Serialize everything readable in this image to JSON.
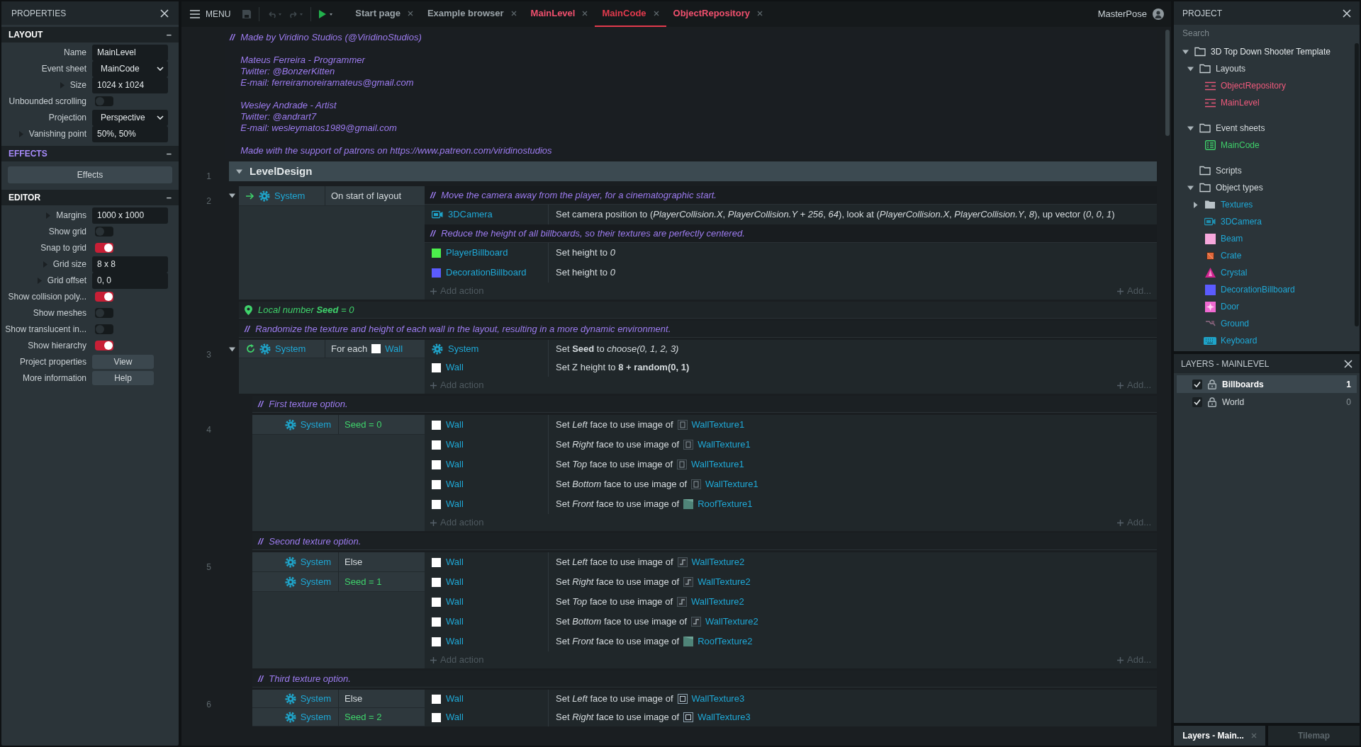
{
  "properties": {
    "title": "PROPERTIES",
    "sections": [
      {
        "title": "LAYOUT",
        "color": "#ffffff",
        "collapse": "–",
        "rows": [
          {
            "kind": "field",
            "label": "Name",
            "value": "MainLevel"
          },
          {
            "kind": "select",
            "label": "Event sheet",
            "value": "MainCode"
          },
          {
            "kind": "field",
            "label": "Size",
            "value": "1024 x 1024",
            "expandable": true
          },
          {
            "kind": "toggle",
            "label": "Unbounded scrolling",
            "on": false
          },
          {
            "kind": "select",
            "label": "Projection",
            "value": "Perspective"
          },
          {
            "kind": "field",
            "label": "Vanishing point",
            "value": "50%, 50%",
            "expandable": true
          }
        ]
      },
      {
        "title": "EFFECTS",
        "color": "#a78bfa",
        "collapse": "–",
        "rows": [
          {
            "kind": "wide_button",
            "value": "Effects"
          }
        ]
      },
      {
        "title": "EDITOR",
        "color": "#ffffff",
        "collapse": "–",
        "rows": [
          {
            "kind": "field",
            "label": "Margins",
            "value": "1000 x 1000",
            "expandable": true
          },
          {
            "kind": "toggle",
            "label": "Show grid",
            "on": false
          },
          {
            "kind": "toggle",
            "label": "Snap to grid",
            "on": true
          },
          {
            "kind": "field",
            "label": "Grid size",
            "value": "8 x 8",
            "expandable": true
          },
          {
            "kind": "field",
            "label": "Grid offset",
            "value": "0, 0",
            "expandable": true
          },
          {
            "kind": "toggle",
            "label": "Show collision poly...",
            "on": true
          },
          {
            "kind": "toggle",
            "label": "Show meshes",
            "on": false
          },
          {
            "kind": "toggle",
            "label": "Show translucent in...",
            "on": false
          },
          {
            "kind": "toggle",
            "label": "Show hierarchy",
            "on": true
          },
          {
            "kind": "button",
            "label": "Project properties",
            "value": "View"
          },
          {
            "kind": "button",
            "label": "More information",
            "value": "Help"
          }
        ]
      }
    ]
  },
  "toolbar": {
    "menu": "MENU",
    "user": "MasterPose"
  },
  "tabs": [
    {
      "label": "Start page",
      "kind": "page",
      "selected": false
    },
    {
      "label": "Example browser",
      "kind": "page",
      "selected": false
    },
    {
      "label": "MainLevel",
      "kind": "project",
      "selected": false
    },
    {
      "label": "MainCode",
      "kind": "project",
      "selected": true
    },
    {
      "label": "ObjectRepository",
      "kind": "project",
      "selected": false
    }
  ],
  "sheet": {
    "header_comment": {
      "marker": "//",
      "paragraphs": [
        [
          "Made by Viridino Studios (@ViridinoStudios)"
        ],
        [
          "Mateus Ferreira - Programmer",
          "Twitter: @BonzerKitten",
          "E-mail: ferreiramoreiramateus@gmail.com"
        ],
        [
          "Wesley Andrade - Artist",
          "Twitter: @andrart7",
          "E-mail: wesleymatos1989@gmail.com"
        ],
        [
          "Made with the support of patrons on https://www.patreon.com/viridinostudios"
        ]
      ]
    },
    "events": [
      {
        "kind": "group",
        "number": "1",
        "title": "LevelDesign",
        "expanded": true,
        "children": [
          {
            "kind": "start_event",
            "number": "2",
            "expanded": true,
            "conditions": [
              {
                "object": "System",
                "text": "On start of layout",
                "expression": false
              }
            ],
            "actions": [
              {
                "kind": "comment",
                "marker": "//",
                "text": "Move the camera away from the player, for a cinematographic start."
              },
              {
                "kind": "camera",
                "object": "3DCamera",
                "text": "Set camera position to (*PlayerCollision.X*, *PlayerCollision.Y + 256*, *64*), look at (*PlayerCollision.X*, *PlayerCollision.Y*, *8*), up vector (*0*, *0*, *1*)"
              },
              {
                "kind": "comment",
                "marker": "//",
                "text": "Reduce the height of all billboards, so their textures are perfectly centered."
              },
              {
                "kind": "swatch",
                "color": "#4cf04c",
                "object": "PlayerBillboard",
                "text": "Set height to *0*"
              },
              {
                "kind": "swatch",
                "color": "#5b5bff",
                "object": "DecorationBillboard",
                "text": "Set height to *0*"
              }
            ],
            "add_action": "Add action",
            "add_more": "Add..."
          },
          {
            "kind": "variable",
            "text": "Local number **Seed** = 0"
          },
          {
            "kind": "comment",
            "marker": "//",
            "text": "Randomize the texture and height of each wall in the layout, resulting in a more dynamic environment."
          },
          {
            "kind": "loop_event",
            "number": "3",
            "expanded": true,
            "conditions": [
              {
                "object": "System",
                "text": "For each",
                "expression": false,
                "param_object": "Wall"
              }
            ],
            "actions": [
              {
                "kind": "system",
                "object": "System",
                "text": "Set **Seed** to *choose(0, 1, 2, 3)*"
              },
              {
                "kind": "swatch",
                "color": "#ffffff",
                "object": "Wall",
                "text": "Set Z height to **8 + random(0, 1)**"
              }
            ],
            "add_action": "Add action",
            "add_more": "Add...",
            "children": [
              {
                "kind": "comment",
                "marker": "//",
                "text": "First texture option."
              },
              {
                "kind": "event",
                "number": "4",
                "conditions": [
                  {
                    "object": "System",
                    "text": "Seed = 0",
                    "expression": true
                  }
                ],
                "actions": [
                  {
                    "kind": "swatch",
                    "color": "#ffffff",
                    "object": "Wall",
                    "text": "Set *Left* face to use image of",
                    "image": {
                      "kind": "wall1",
                      "name": "WallTexture1"
                    }
                  },
                  {
                    "kind": "swatch",
                    "color": "#ffffff",
                    "object": "Wall",
                    "text": "Set *Right* face to use image of",
                    "image": {
                      "kind": "wall1",
                      "name": "WallTexture1"
                    }
                  },
                  {
                    "kind": "swatch",
                    "color": "#ffffff",
                    "object": "Wall",
                    "text": "Set *Top* face to use image of",
                    "image": {
                      "kind": "wall1",
                      "name": "WallTexture1"
                    }
                  },
                  {
                    "kind": "swatch",
                    "color": "#ffffff",
                    "object": "Wall",
                    "text": "Set *Bottom* face to use image of",
                    "image": {
                      "kind": "wall1",
                      "name": "WallTexture1"
                    }
                  },
                  {
                    "kind": "swatch",
                    "color": "#ffffff",
                    "object": "Wall",
                    "text": "Set *Front* face to use image of",
                    "image": {
                      "kind": "roof",
                      "name": "RoofTexture1"
                    }
                  }
                ],
                "add_action": "Add action",
                "add_more": "Add..."
              },
              {
                "kind": "comment",
                "marker": "//",
                "text": "Second texture option."
              },
              {
                "kind": "event",
                "number": "5",
                "conditions": [
                  {
                    "object": "System",
                    "text": "Else",
                    "expression": false
                  },
                  {
                    "object": "System",
                    "text": "Seed = 1",
                    "expression": true
                  }
                ],
                "actions": [
                  {
                    "kind": "swatch",
                    "color": "#ffffff",
                    "object": "Wall",
                    "text": "Set *Left* face to use image of",
                    "image": {
                      "kind": "wall2",
                      "name": "WallTexture2"
                    }
                  },
                  {
                    "kind": "swatch",
                    "color": "#ffffff",
                    "object": "Wall",
                    "text": "Set *Right* face to use image of",
                    "image": {
                      "kind": "wall2",
                      "name": "WallTexture2"
                    }
                  },
                  {
                    "kind": "swatch",
                    "color": "#ffffff",
                    "object": "Wall",
                    "text": "Set *Top* face to use image of",
                    "image": {
                      "kind": "wall2",
                      "name": "WallTexture2"
                    }
                  },
                  {
                    "kind": "swatch",
                    "color": "#ffffff",
                    "object": "Wall",
                    "text": "Set *Bottom* face to use image of",
                    "image": {
                      "kind": "wall2",
                      "name": "WallTexture2"
                    }
                  },
                  {
                    "kind": "swatch",
                    "color": "#ffffff",
                    "object": "Wall",
                    "text": "Set *Front* face to use image of",
                    "image": {
                      "kind": "roof",
                      "name": "RoofTexture2"
                    }
                  }
                ],
                "add_action": "Add action",
                "add_more": "Add..."
              },
              {
                "kind": "comment",
                "marker": "//",
                "text": "Third texture option."
              },
              {
                "kind": "event",
                "number": "6",
                "conditions": [
                  {
                    "object": "System",
                    "text": "Else",
                    "expression": false
                  },
                  {
                    "object": "System",
                    "text": "Seed = 2",
                    "expression": true
                  }
                ],
                "actions": [
                  {
                    "kind": "swatch",
                    "color": "#ffffff",
                    "object": "Wall",
                    "text": "Set *Left* face to use image of",
                    "image": {
                      "kind": "wall3",
                      "name": "WallTexture3"
                    }
                  },
                  {
                    "kind": "swatch",
                    "color": "#ffffff",
                    "object": "Wall",
                    "text": "Set *Right* face to use image of",
                    "image": {
                      "kind": "wall3",
                      "name": "WallTexture3"
                    }
                  }
                ]
              }
            ]
          }
        ]
      }
    ]
  },
  "project": {
    "title": "PROJECT",
    "search_placeholder": "Search",
    "tree": [
      {
        "label": "3D Top Down Shooter Template",
        "kind": "folder",
        "expanded": true,
        "children": [
          {
            "label": "Layouts",
            "kind": "folder",
            "expanded": true,
            "children": [
              {
                "label": "ObjectRepository",
                "kind": "layout"
              },
              {
                "label": "MainLevel",
                "kind": "layout"
              }
            ]
          },
          {
            "label": "Event sheets",
            "kind": "folder",
            "expanded": true,
            "children": [
              {
                "label": "MainCode",
                "kind": "sheet"
              }
            ]
          },
          {
            "label": "Scripts",
            "kind": "folder"
          },
          {
            "label": "Object types",
            "kind": "folder",
            "expanded": true,
            "children": [
              {
                "label": "Textures",
                "kind": "family_folder",
                "expanded": false
              },
              {
                "label": "3DCamera",
                "kind": "camera"
              },
              {
                "label": "Beam",
                "kind": "beam"
              },
              {
                "label": "Crate",
                "kind": "crate"
              },
              {
                "label": "Crystal",
                "kind": "crystal"
              },
              {
                "label": "DecorationBillboard",
                "kind": "decoration"
              },
              {
                "label": "Door",
                "kind": "door"
              },
              {
                "label": "Ground",
                "kind": "ground"
              },
              {
                "label": "Keyboard",
                "kind": "keyboard"
              }
            ]
          }
        ]
      }
    ]
  },
  "layers": {
    "title": "LAYERS - MAINLEVEL",
    "items": [
      {
        "name": "Billboards",
        "count": "1",
        "selected": true,
        "visible": true
      },
      {
        "name": "World",
        "count": "0",
        "selected": false,
        "visible": true
      }
    ]
  },
  "bottom_tabs": [
    {
      "label": "Layers - Main...",
      "selected": true
    },
    {
      "label": "Tilemap",
      "selected": false
    }
  ]
}
